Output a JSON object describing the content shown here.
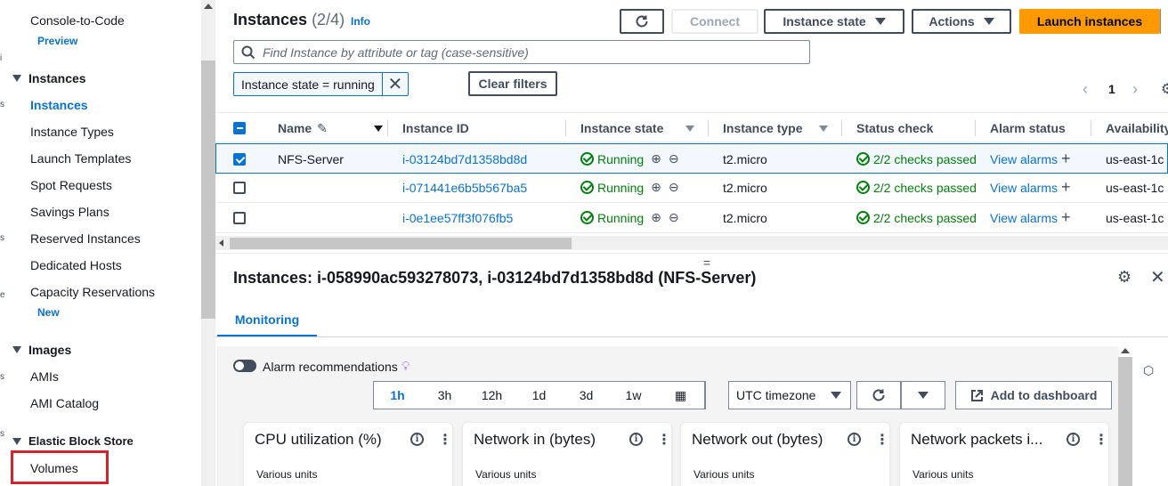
{
  "sidebar": {
    "items": [
      {
        "label": "Console-to-Code",
        "badge": "Preview"
      },
      {
        "section": "Instances"
      },
      {
        "label": "Instances",
        "active": true
      },
      {
        "label": "Instance Types"
      },
      {
        "label": "Launch Templates"
      },
      {
        "label": "Spot Requests"
      },
      {
        "label": "Savings Plans"
      },
      {
        "label": "Reserved Instances"
      },
      {
        "label": "Dedicated Hosts"
      },
      {
        "label": "Capacity Reservations",
        "badge": "New"
      },
      {
        "section": "Images"
      },
      {
        "label": "AMIs"
      },
      {
        "label": "AMI Catalog"
      },
      {
        "section": "Elastic Block Store"
      },
      {
        "label": "Volumes",
        "highlighted": true
      }
    ]
  },
  "header": {
    "title": "Instances",
    "count": "(2/4)",
    "info": "Info",
    "connect": "Connect",
    "instance_state": "Instance state",
    "actions": "Actions",
    "launch": "Launch instances"
  },
  "search": {
    "placeholder": "Find Instance by attribute or tag (case-sensitive)"
  },
  "filter": {
    "token": "Instance state = running",
    "clear": "Clear filters"
  },
  "pagination": {
    "page": "1"
  },
  "table": {
    "columns": [
      "Name",
      "Instance ID",
      "Instance state",
      "Instance type",
      "Status check",
      "Alarm status",
      "Availability"
    ],
    "rows": [
      {
        "selected": true,
        "name": "NFS-Server",
        "id": "i-03124bd7d1358bd8d",
        "state": "Running",
        "type": "t2.micro",
        "status": "2/2 checks passed",
        "alarm": "View alarms",
        "az": "us-east-1c"
      },
      {
        "selected": false,
        "name": "",
        "id": "i-071441e6b5b567ba5",
        "state": "Running",
        "type": "t2.micro",
        "status": "2/2 checks passed",
        "alarm": "View alarms",
        "az": "us-east-1c"
      },
      {
        "selected": false,
        "name": "",
        "id": "i-0e1ee57ff3f076fb5",
        "state": "Running",
        "type": "t2.micro",
        "status": "2/2 checks passed",
        "alarm": "View alarms",
        "az": "us-east-1c"
      }
    ]
  },
  "details": {
    "title": "Instances: i-058990ac593278073, i-03124bd7d1358bd8d (NFS-Server)",
    "tab": "Monitoring",
    "alarm_recommendations": "Alarm recommendations",
    "time_ranges": [
      "1h",
      "3h",
      "12h",
      "1d",
      "3d",
      "1w"
    ],
    "active_range": "1h",
    "timezone": "UTC timezone",
    "add_dashboard": "Add to dashboard",
    "metrics": [
      {
        "title": "CPU utilization (%)",
        "units": "Various units"
      },
      {
        "title": "Network in (bytes)",
        "units": "Various units"
      },
      {
        "title": "Network out (bytes)",
        "units": "Various units"
      },
      {
        "title": "Network packets i...",
        "units": "Various units"
      }
    ]
  },
  "colors": {
    "accent": "#0972d3",
    "primary": "#ff9900",
    "success": "#037f0c",
    "highlight": "#d1242f"
  }
}
